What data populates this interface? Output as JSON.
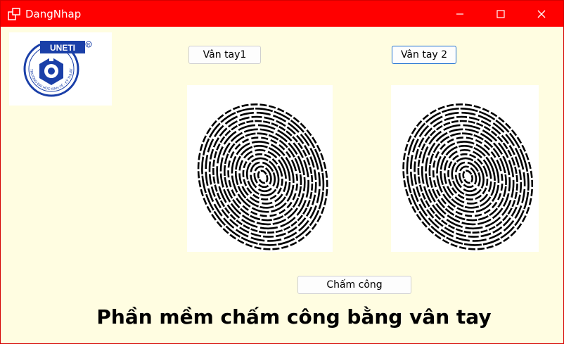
{
  "window": {
    "title": "DangNhap",
    "titlebar_color": "#ff0000",
    "background_color": "#fffde1"
  },
  "logo": {
    "text": "UNETI",
    "ring_text": "TRƯỜNG ĐẠI HỌC KINH TẾ - KỸ THUẬT CÔNG NGHIỆP",
    "brand_color": "#1a3fa8"
  },
  "buttons": {
    "fingerprint1": "Vân tay1",
    "fingerprint2": "Vân tay 2",
    "checkin": "Chấm công"
  },
  "footer": {
    "title": "Phần mềm chấm công bằng vân tay"
  },
  "icons": {
    "app": "window-icon",
    "minimize": "minimize-icon",
    "maximize": "maximize-icon",
    "close": "close-icon",
    "fingerprint": "fingerprint-icon"
  }
}
